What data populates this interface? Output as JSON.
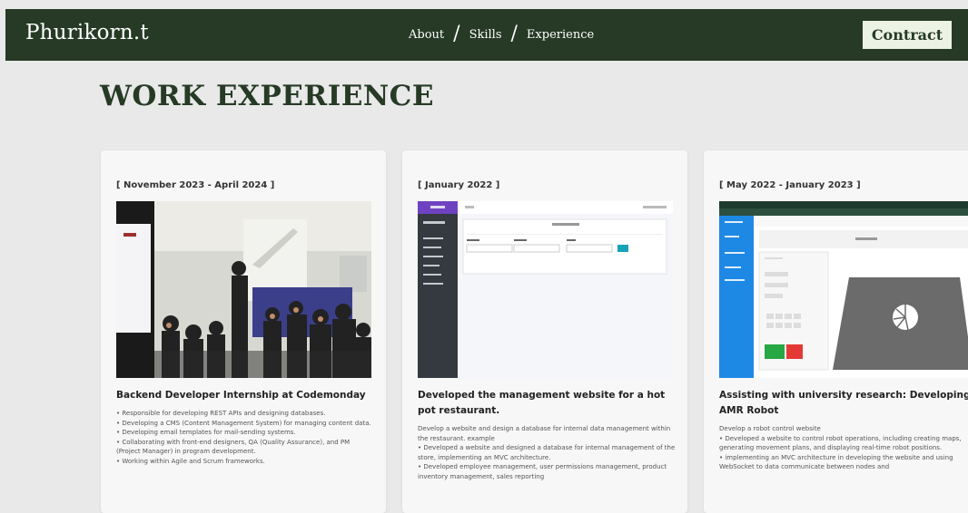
{
  "nav": {
    "brand": "Phurikorn.t",
    "links": [
      "About",
      "Skills",
      "Experience"
    ],
    "separator": "/",
    "contract_label": "Contract"
  },
  "section": {
    "title": "WORK EXPERIENCE"
  },
  "cards": [
    {
      "date": "[ November 2023 - April 2024 ]",
      "title": "Backend Developer Internship at Codemonday",
      "description": [
        "• Responsible for developing REST APIs and designing databases.",
        "• Developing a CMS (Content Management System) for managing content data.",
        "• Developing email templates for mail-sending systems.",
        "• Collaborating with front-end designers, QA (Quality Assurance), and PM (Project Manager) in program development.",
        "• Working within Agile and Scrum frameworks."
      ]
    },
    {
      "date": "[ January 2022 ]",
      "title": "Developed the management website for a hot pot restaurant.",
      "description": [
        "Develop a website and design a database for internal data management within the restaurant. example",
        "• Developed a website and designed a database for internal management of the store, implementing an MVC architecture.",
        "• Developed employee management, user permissions management, product inventory management, sales reporting"
      ]
    },
    {
      "date": "[ May 2022 - January 2023 ]",
      "title": "Assisting with university research: Developing AMR Robot",
      "description": [
        "Develop a robot control website",
        "• Developed a website to control robot operations, including creating maps, generating movement plans, and displaying real-time robot positions.",
        "• implementing an MVC architecture in developing the website and using WebSocket to data communicate between nodes and"
      ]
    }
  ],
  "colors": {
    "navbar": "#263a25",
    "title": "#263a25",
    "page_bg": "#e9e9e9",
    "card_bg": "#f7f7f7",
    "contract_bg": "#ecf2e4",
    "dashboard_sidebar": "#343a40",
    "dashboard_brand": "#6f42c1",
    "robot_sidebar": "#1e88e5",
    "robot_go": "#28a745",
    "robot_stop": "#e53935"
  }
}
